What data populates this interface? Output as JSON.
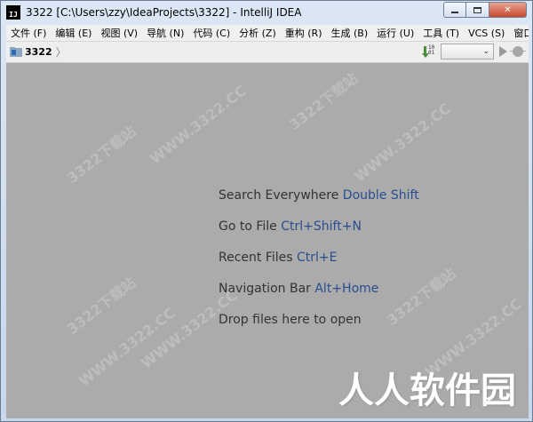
{
  "window": {
    "title": "3322 [C:\\Users\\zzy\\IdeaProjects\\3322] - IntelliJ IDEA",
    "app_icon_text": "IJ"
  },
  "menubar": {
    "items": [
      "文件 (F)",
      "编辑 (E)",
      "视图 (V)",
      "导航 (N)",
      "代码 (C)",
      "分析 (Z)",
      "重构 (R)",
      "生成 (B)",
      "运行 (U)",
      "工具 (T)",
      "VCS (S)",
      "窗口 ("
    ]
  },
  "navbar": {
    "crumb": "3322",
    "build_bits": "10\n01",
    "run_config_value": "",
    "run_config_arrow": "⌄"
  },
  "editor": {
    "hints": [
      {
        "text": "Search Everywhere",
        "shortcut": "Double Shift"
      },
      {
        "text": "Go to File",
        "shortcut": "Ctrl+Shift+N"
      },
      {
        "text": "Recent Files",
        "shortcut": "Ctrl+E"
      },
      {
        "text": "Navigation Bar",
        "shortcut": "Alt+Home"
      },
      {
        "text": "Drop files here to open",
        "shortcut": ""
      }
    ]
  },
  "watermarks": {
    "site": "WWW.3322.CC",
    "brand": "3322下载站",
    "corner_logo": "人人软件园"
  },
  "colors": {
    "editor_bg": "#ababab",
    "shortcut": "#2a4d8f"
  }
}
